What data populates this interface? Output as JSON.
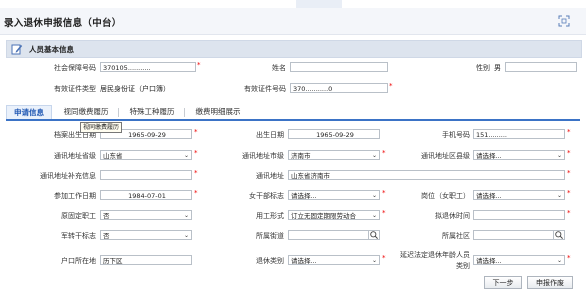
{
  "window": {
    "title": "录入退休申报信息（中台）"
  },
  "section": {
    "title": "人员基本信息"
  },
  "basic": {
    "ssn_label": "社会保障号码",
    "ssn_value": "370105...........",
    "name_label": "姓名",
    "name_value": "",
    "gender_label": "性别",
    "gender_value": "男",
    "idtype_label": "有效证件类型",
    "idtype_value": "居民身份证（户口簿）",
    "idno_label": "有效证件号码",
    "idno_value": "370...........0"
  },
  "tabs": [
    {
      "label": "申请信息"
    },
    {
      "label": "视同缴费履历"
    },
    {
      "label": "特殊工种履历"
    },
    {
      "label": "缴费明细展示"
    }
  ],
  "tooltip": "视同缴费履历",
  "form": {
    "archive_birth_label": "档案出生日期",
    "archive_birth_value": "1965-09-29",
    "birth_label": "出生日期",
    "birth_value": "1965-09-29",
    "phone_label": "手机号码",
    "phone_value": "151.........",
    "province_label": "通讯地址省级",
    "province_value": "山东省",
    "city_label": "通讯地址市级",
    "city_value": "济南市",
    "district_label": "通讯地址区县级",
    "district_value": "请选择...",
    "addr_supp_label": "通讯地址补充信息",
    "addr_supp_value": "",
    "addr_label": "通讯地址",
    "addr_value": "山东省济南市",
    "work_date_label": "参加工作日期",
    "work_date_value": "1984-07-01",
    "female_cadre_label": "女干部标志",
    "female_cadre_value": "请选择...",
    "post_label": "岗位（女职工）",
    "post_value": "请选择...",
    "orig_fixed_label": "原固定职工",
    "orig_fixed_value": "否",
    "employ_label": "用工形式",
    "employ_value": "订立无固定期限劳动合",
    "retire_time_label": "拟退休时间",
    "retire_time_value": "",
    "army_label": "军转干标志",
    "army_value": "否",
    "street_label": "所属街道",
    "street_value": "",
    "community_label": "所属社区",
    "community_value": "",
    "hukou_label": "户口所在地",
    "hukou_value": "历下区",
    "retire_type_label": "退休类别",
    "retire_type_value": "请选择...",
    "delay_label_1": "延迟法定退休年龄人员",
    "delay_label_2": "类别",
    "delay_value": "请选择..."
  },
  "buttons": {
    "next": "下一步",
    "submit": "申报作废"
  },
  "colors": {
    "accent": "#3b73c6",
    "required": "#ee0000"
  }
}
